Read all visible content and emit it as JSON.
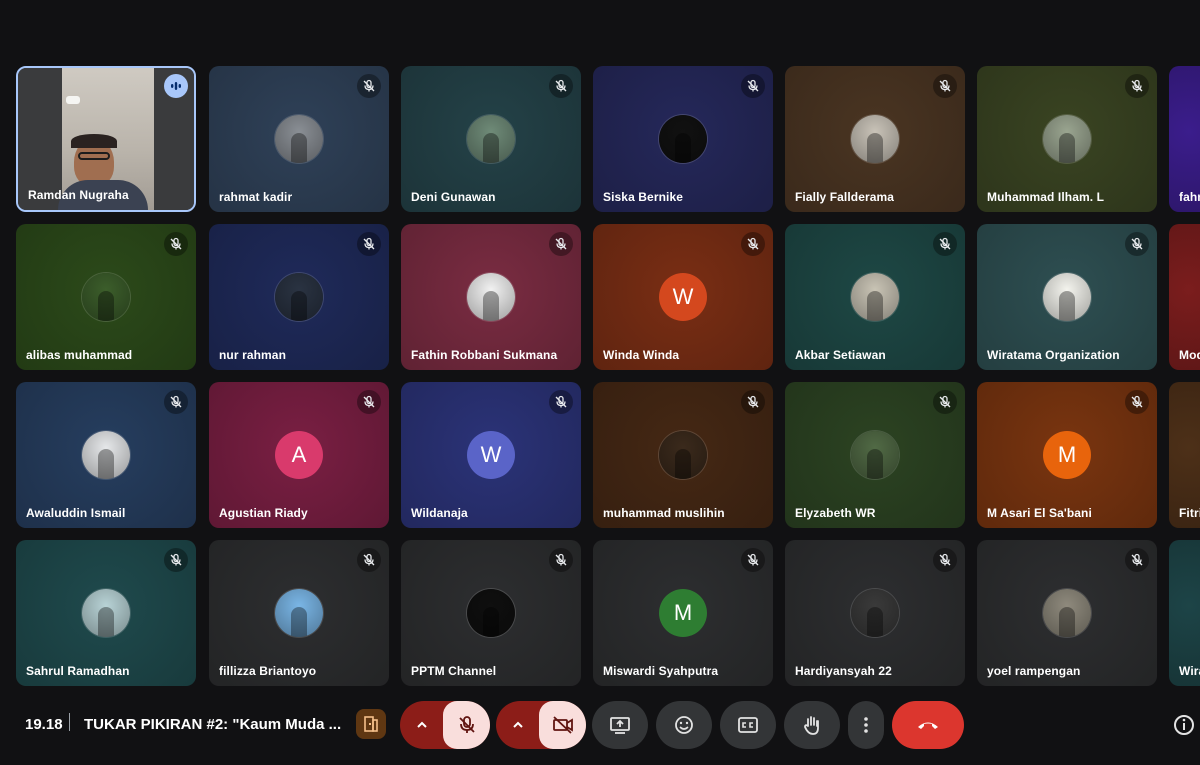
{
  "grid": {
    "rows": [
      [
        {
          "name": "Ramdan Nugraha",
          "kind": "video",
          "active": true
        },
        {
          "name": "rahmat kadir",
          "bg": "#2f4158",
          "avatar": "photo",
          "photo_color": "#8a8f95"
        },
        {
          "name": "Deni Gunawan",
          "bg": "#244248",
          "avatar": "photo",
          "photo_color": "#6f8b78"
        },
        {
          "name": "Siska Bernike",
          "bg": "#25285a",
          "avatar": "photo",
          "photo_color": "#111111"
        },
        {
          "name": "Fially Fallderama",
          "bg": "#4a3522",
          "avatar": "photo",
          "photo_color": "#c9c3b8"
        },
        {
          "name": "Muhammad Ilham. L",
          "bg": "#3a4422",
          "avatar": "photo",
          "photo_color": "#9aa590"
        },
        {
          "name": "fahm",
          "bg": "#3b1d8c",
          "partial": true
        }
      ],
      [
        {
          "name": "alibas muhammad",
          "bg": "#2c4a1a",
          "avatar": "photo",
          "photo_color": "#3c5e2b"
        },
        {
          "name": "nur rahman",
          "bg": "#1f2a5a",
          "avatar": "photo",
          "photo_color": "#2a3342"
        },
        {
          "name": "Fathin Robbani Sukmana",
          "bg": "#7a2c42",
          "avatar": "photo",
          "photo_color": "#f2f2f2"
        },
        {
          "name": "Winda Winda",
          "bg": "#7a2e14",
          "avatar": "letter",
          "letter": "W",
          "letter_bg": "#d4481e"
        },
        {
          "name": "Akbar Setiawan",
          "bg": "#1e4845",
          "avatar": "photo",
          "photo_color": "#c9c4b5"
        },
        {
          "name": "Wiratama Organization",
          "bg": "#2e4f52",
          "avatar": "photo",
          "photo_color": "#f4f4ee"
        },
        {
          "name": "Mod",
          "bg": "#7b1d1d",
          "partial": true
        }
      ],
      [
        {
          "name": "Awaluddin Ismail",
          "bg": "#263e5f",
          "avatar": "photo",
          "photo_color": "#e6e8ea"
        },
        {
          "name": "Agustian Riady",
          "bg": "#7a1f43",
          "avatar": "letter",
          "letter": "A",
          "letter_bg": "#d93a6c"
        },
        {
          "name": "Wildanaja",
          "bg": "#2b3378",
          "avatar": "letter",
          "letter": "W",
          "letter_bg": "#5a64c8"
        },
        {
          "name": "muhammad muslihin",
          "bg": "#452814",
          "avatar": "photo",
          "photo_color": "#3b2a1c"
        },
        {
          "name": "Elyzabeth WR",
          "bg": "#2c4322",
          "avatar": "photo",
          "photo_color": "#516a45"
        },
        {
          "name": "M Asari El Sa'bani",
          "bg": "#7a3510",
          "avatar": "letter",
          "letter": "M",
          "letter_bg": "#e8640c"
        },
        {
          "name": "Fitri",
          "bg": "#4d3018",
          "partial": true
        }
      ],
      [
        {
          "name": "Sahrul Ramadhan",
          "bg": "#1f4a4d",
          "avatar": "photo",
          "photo_color": "#b8d3d6"
        },
        {
          "name": "fillizza Briantoyo",
          "bg": "#2d2e30",
          "avatar": "photo",
          "photo_color": "#7ab6e6"
        },
        {
          "name": "PPTM Channel",
          "bg": "#2d2e30",
          "avatar": "photo",
          "photo_color": "#0f0f0f"
        },
        {
          "name": "Miswardi Syahputra",
          "bg": "#2d2e30",
          "avatar": "letter",
          "letter": "M",
          "letter_bg": "#2e7d32"
        },
        {
          "name": "Hardiyansyah 22",
          "bg": "#2d2e30",
          "avatar": "photo",
          "photo_color": "#3a3a3a"
        },
        {
          "name": "yoel rampengan",
          "bg": "#2d2e30",
          "avatar": "photo",
          "photo_color": "#8f8a7d"
        },
        {
          "name": "Wira",
          "bg": "#1d4447",
          "partial": true
        }
      ]
    ]
  },
  "bottom": {
    "time": "19.18",
    "meeting_title": "TUKAR PIKIRAN #2: \"Kaum Muda ...",
    "colors": {
      "mic_off_bg": "#f9dedc",
      "danger_group": "#8c1d18",
      "end_call": "#dc362e",
      "button": "#333537"
    }
  },
  "icons": [
    "speaking-icon",
    "mic-off-icon",
    "host-controls-icon",
    "chevron-up-icon",
    "camera-off-icon",
    "present-screen-icon",
    "emoji-icon",
    "captions-icon",
    "raise-hand-icon",
    "more-options-icon",
    "end-call-icon",
    "info-icon"
  ]
}
